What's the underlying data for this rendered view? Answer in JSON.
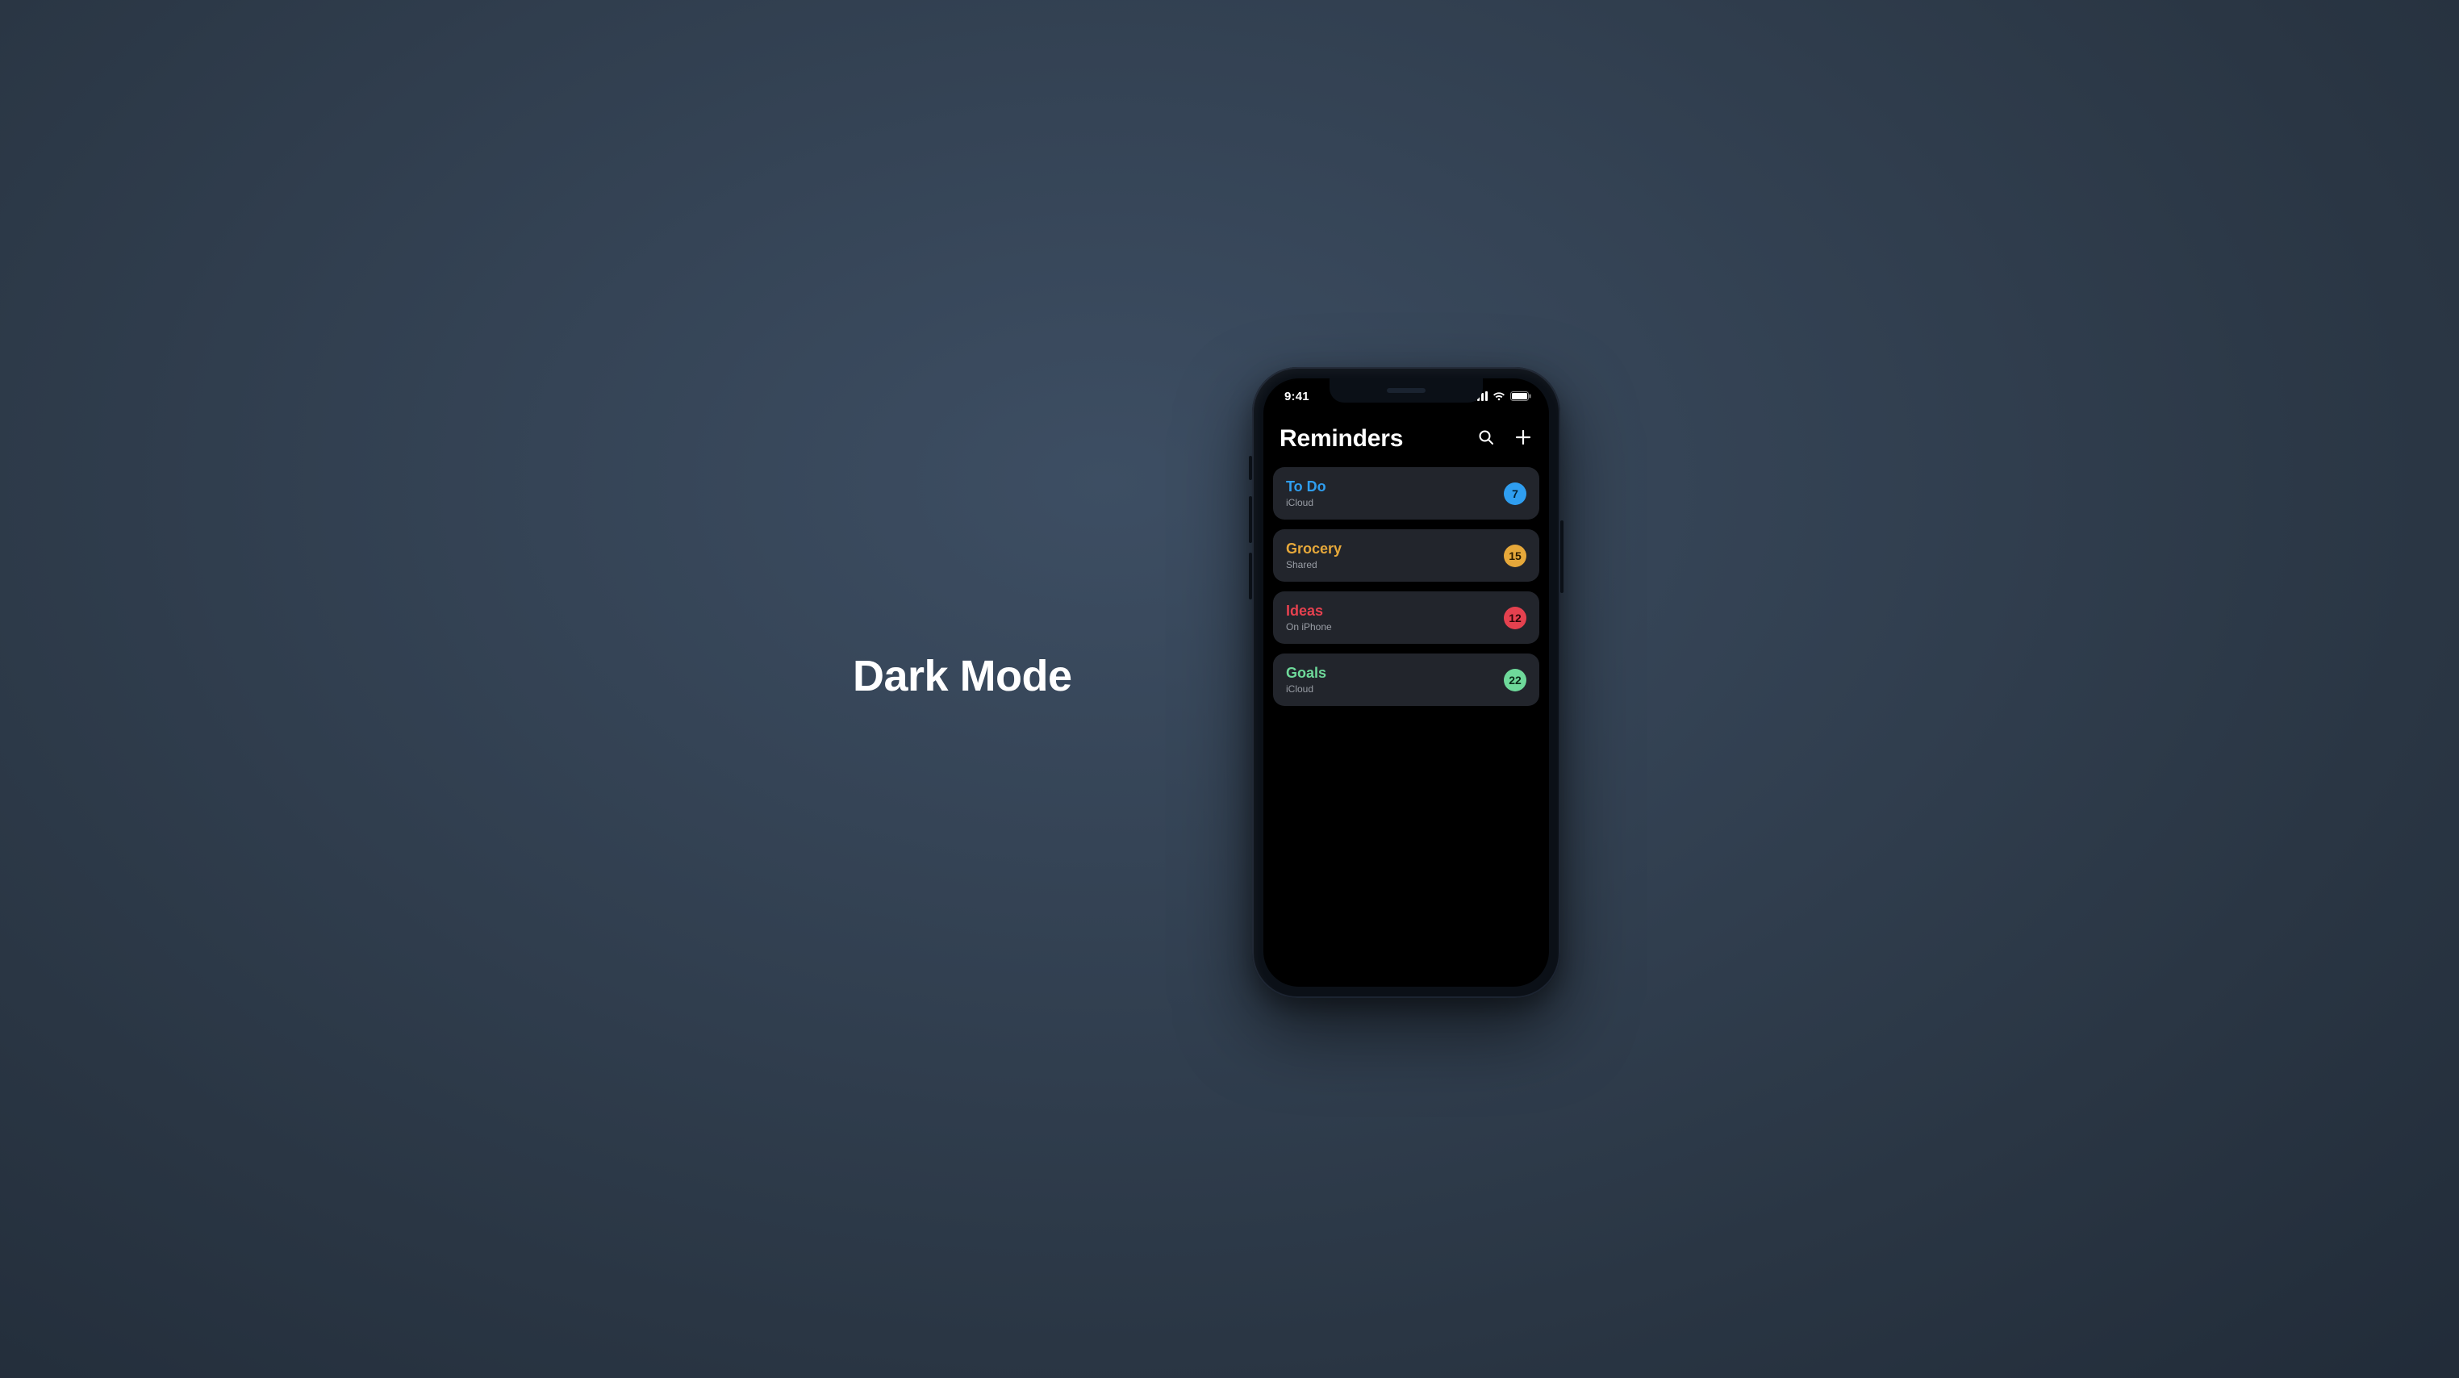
{
  "caption": "Dark Mode",
  "status": {
    "time": "9:41"
  },
  "header": {
    "title": "Reminders"
  },
  "lists": [
    {
      "title": "To Do",
      "subtitle": "iCloud",
      "count": "7",
      "title_color": "#2f9ef0",
      "badge_bg": "#2f9ef0",
      "badge_fg": "#032235"
    },
    {
      "title": "Grocery",
      "subtitle": "Shared",
      "count": "15",
      "title_color": "#e6a83a",
      "badge_bg": "#e6a83a",
      "badge_fg": "#2b1c00"
    },
    {
      "title": "Ideas",
      "subtitle": "On iPhone",
      "count": "12",
      "title_color": "#e5414f",
      "badge_bg": "#e5414f",
      "badge_fg": "#2a0609"
    },
    {
      "title": "Goals",
      "subtitle": "iCloud",
      "count": "22",
      "title_color": "#6ed99a",
      "badge_bg": "#6ed99a",
      "badge_fg": "#0b2a18"
    }
  ]
}
